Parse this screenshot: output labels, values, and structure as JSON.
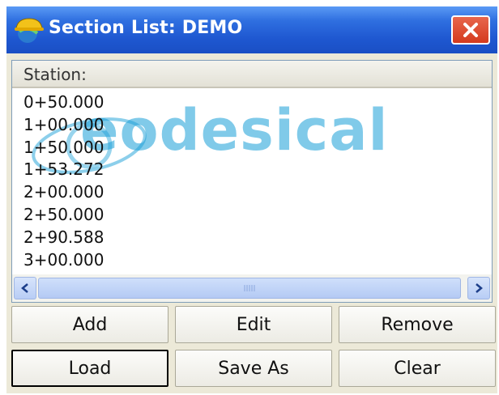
{
  "window": {
    "title": "Section List: DEMO"
  },
  "list": {
    "column_header": "Station:",
    "stations": [
      "0+50.000",
      "1+00.000",
      "1+50.000",
      "1+53.272",
      "2+00.000",
      "2+50.000",
      "2+90.588",
      "3+00.000"
    ]
  },
  "watermark": "eodesical",
  "buttons": {
    "add": "Add",
    "edit": "Edit",
    "remove": "Remove",
    "load": "Load",
    "save_as": "Save As",
    "clear": "Clear"
  },
  "icons": {
    "app": "hardhat-globe-icon",
    "close": "close-icon",
    "scroll_left": "arrow-left-icon",
    "scroll_right": "arrow-right-icon",
    "grip": "grip-icon"
  },
  "colors": {
    "titlebar": "#2f6fe0",
    "close_button": "#d43a1e",
    "watermark": "#1a9fd8",
    "window_bg": "#ece9d8"
  }
}
